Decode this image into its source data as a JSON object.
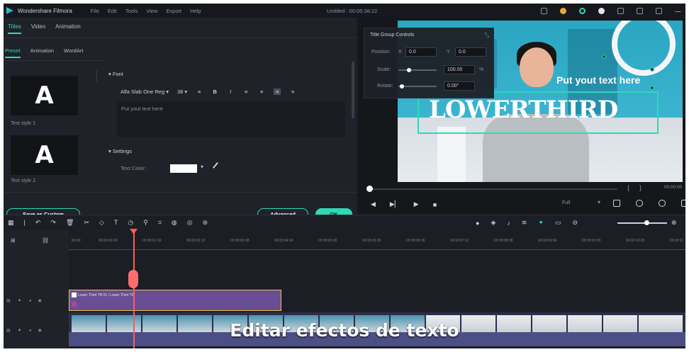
{
  "titlebar": {
    "app_name": "Wondershare Filmora",
    "menus": [
      "File",
      "Edit",
      "Tools",
      "View",
      "Export",
      "Help"
    ],
    "document": "Untitled : 00:05:38:22"
  },
  "editor": {
    "tabs": [
      "Titles",
      "Video",
      "Animation"
    ],
    "active_tab": "Titles",
    "subtabs": [
      "Preset",
      "Animation",
      "WordArt"
    ],
    "active_subtab": "Preset",
    "styles": [
      {
        "glyph": "A",
        "label": "Text style 1"
      },
      {
        "glyph": "A",
        "label": "Text style 2"
      }
    ],
    "font_section": "Font",
    "font_name": "Alfa Slab One Reg",
    "font_size": "38",
    "text_value": "Put yout text here",
    "settings_section": "Settings",
    "text_color_label": "Text Color:",
    "text_color": "#ffffff",
    "save_custom": "Save as Custom",
    "advanced": "Advanced",
    "ok": "OK"
  },
  "controls": {
    "title": "Title Group Controls",
    "position_label": "Position:",
    "x_label": "X",
    "x_value": "0.0",
    "y_label": "Y",
    "y_value": "0.0",
    "scale_label": "Scale:",
    "scale_value": "100.00",
    "scale_unit": "%",
    "rotate_label": "Rotate:",
    "rotate_value": "0.00°"
  },
  "preview": {
    "lower_third_main": "LOWERTHIRD",
    "lower_third_sub": "Put yout text here",
    "timecode": "00:00:00",
    "quality": "Full"
  },
  "timeline": {
    "ticks": [
      "00:00",
      "00:00:00:20",
      "00:00:01:16",
      "00:00:02:12",
      "00:00:03:08",
      "00:00:04:04",
      "00:00:05:00",
      "00:00:05:20",
      "00:00:06:16",
      "00:00:07:12",
      "00:00:08:08",
      "00:00:09:04",
      "00:00:10:00",
      "00:00:10:20",
      "00:00:11"
    ],
    "title_clip_label": "Lower Third TB 01 / Lower Third TB"
  },
  "subtitle": "Editar efectos de texto",
  "colors": {
    "accent": "#2fd9b8",
    "playhead": "#ff5a5a",
    "title_clip": "#6a4e93"
  }
}
